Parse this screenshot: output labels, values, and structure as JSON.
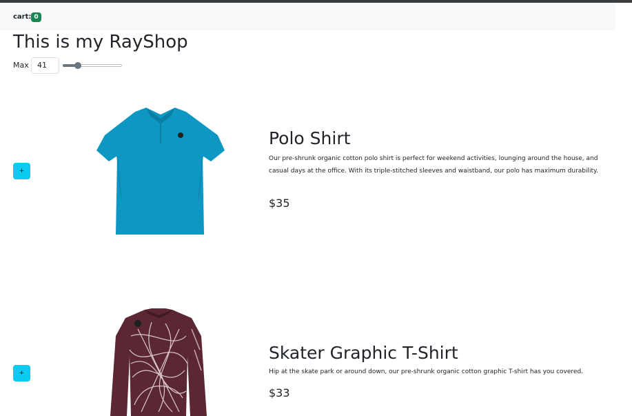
{
  "header": {
    "cart_label": "cart:",
    "cart_count": "0"
  },
  "page": {
    "title": "This is my RayShop"
  },
  "filter": {
    "max_label": "Max",
    "max_value": "41",
    "slider_level_fraction": 0.26
  },
  "products": [
    {
      "add_label": "+",
      "name": "Polo Shirt",
      "description": "Our pre-shrunk organic cotton polo shirt is perfect for weekend activities, lounging around the house, and casual days at the office. With its triple-stitched sleeves and waistband, our polo has maximum durability.",
      "price": "$35",
      "image_color": "#0f97c3"
    },
    {
      "add_label": "+",
      "name": "Skater Graphic T-Shirt",
      "description": "Hip at the skate park or around down, our pre-shrunk organic cotton graphic T-shirt has you covered.",
      "price": "$33",
      "image_color": "#5a2733"
    }
  ]
}
